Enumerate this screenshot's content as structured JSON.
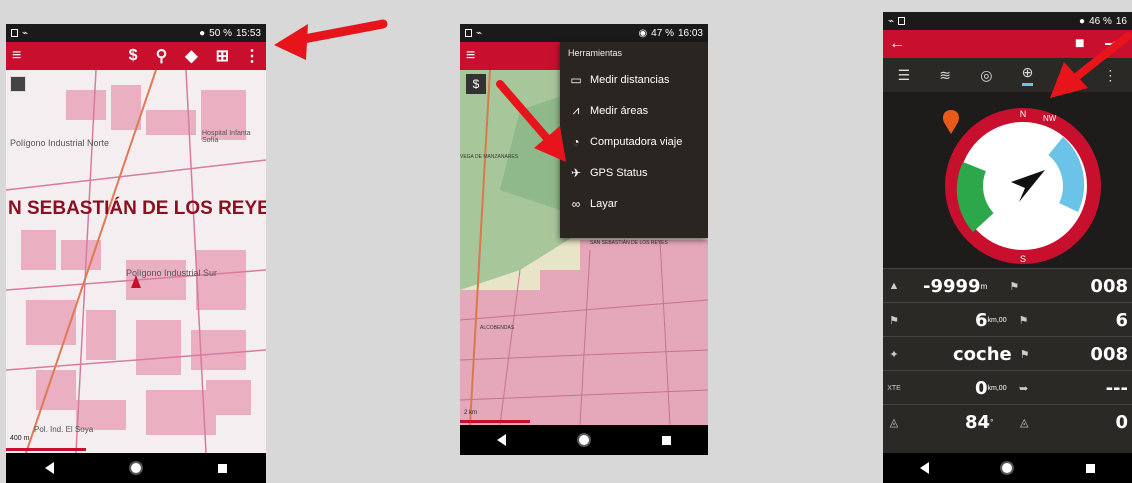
{
  "phone1": {
    "status": {
      "time": "15:53",
      "battery": "50 %"
    },
    "map": {
      "labels": {
        "poligono_norte": "Polígono Industrial Norte",
        "hospital": "Hospital Infanta Sofía",
        "city": "N SEBASTIÁN DE LOS REYE",
        "poligono_sur": "Polígono Industrial Sur",
        "pol_ind": "Pol. Ind. El Soya",
        "scale": "400 m"
      }
    }
  },
  "phone2": {
    "status": {
      "time": "16:03",
      "battery": "47 %"
    },
    "menu": {
      "title": "Herramientas",
      "items": [
        {
          "label": "Medir distancias",
          "icon": "ruler-icon"
        },
        {
          "label": "Medir áreas",
          "icon": "area-icon"
        },
        {
          "label": "Computadora viaje",
          "icon": "trip-computer-icon"
        },
        {
          "label": "GPS Status",
          "icon": "satellite-icon"
        },
        {
          "label": "Layar",
          "icon": "layar-icon"
        }
      ]
    },
    "map": {
      "labels": {
        "vega": "VEGA DE MANZANARES",
        "sanse": "SAN SEBASTIÁN DE LOS REYES",
        "alcobendas": "ALCOBENDAS",
        "scale": "2 km"
      }
    }
  },
  "phone3": {
    "status": {
      "battery": "46 %",
      "time": "16"
    },
    "compass": {
      "heading_label": "NW"
    },
    "rows": [
      {
        "icon": "altitude-icon",
        "value": "-9999",
        "unit": "m",
        "right_value": "008"
      },
      {
        "icon": "flag-icon",
        "value": "6",
        "unit": "km,00",
        "right_value": "6"
      },
      {
        "icon": "pin-icon",
        "value": "coche",
        "unit": "",
        "right_value": "008"
      },
      {
        "icon": "xte-icon",
        "label": "XTE",
        "value": "0",
        "unit": "km,00",
        "right_value": "---"
      },
      {
        "icon": "bearing-icon",
        "value": "84",
        "unit": "°",
        "right_value": "0"
      }
    ]
  },
  "colors": {
    "brand": "#c8102e",
    "arrow": "#e8141c",
    "compass_blue": "#6cc3e8",
    "compass_green": "#2ca84a"
  }
}
